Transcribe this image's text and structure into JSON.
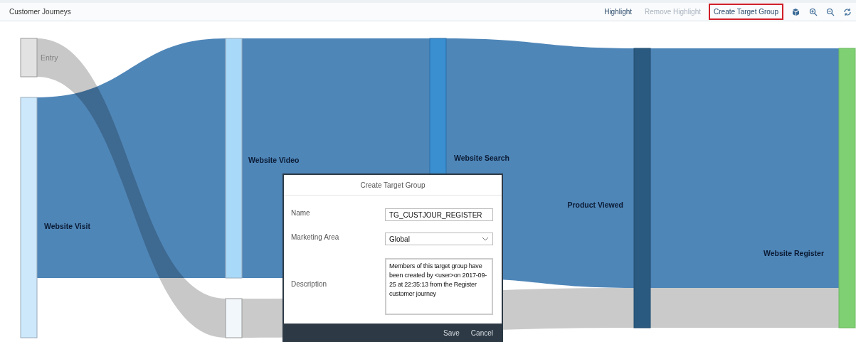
{
  "toolbar": {
    "title": "Customer Journeys",
    "actions": [
      {
        "label": "Highlight",
        "disabled": false,
        "outlined": false
      },
      {
        "label": "Remove Highlight",
        "disabled": true,
        "outlined": false
      },
      {
        "label": "Create Target Group",
        "disabled": false,
        "outlined": true
      }
    ]
  },
  "diagram": {
    "nodes": [
      {
        "label": "Entry"
      },
      {
        "label": "Website Visit"
      },
      {
        "label": "Website Video"
      },
      {
        "label": "Website Search"
      },
      {
        "label": "Product Viewed"
      },
      {
        "label": "Website Register"
      }
    ]
  },
  "dialog": {
    "title": "Create Target Group",
    "fields": [
      {
        "label": "Name",
        "kind": "text",
        "value": "TG_CUSTJOUR_REGISTER"
      },
      {
        "label": "Marketing Area",
        "kind": "select",
        "value": "Global"
      },
      {
        "label": "Description",
        "kind": "textarea",
        "value": "Members of this target group have been created by <user>on 2017-09-25 at 22:35:13 from the Register customer journey"
      }
    ],
    "buttons": [
      "Save",
      "Cancel"
    ]
  }
}
